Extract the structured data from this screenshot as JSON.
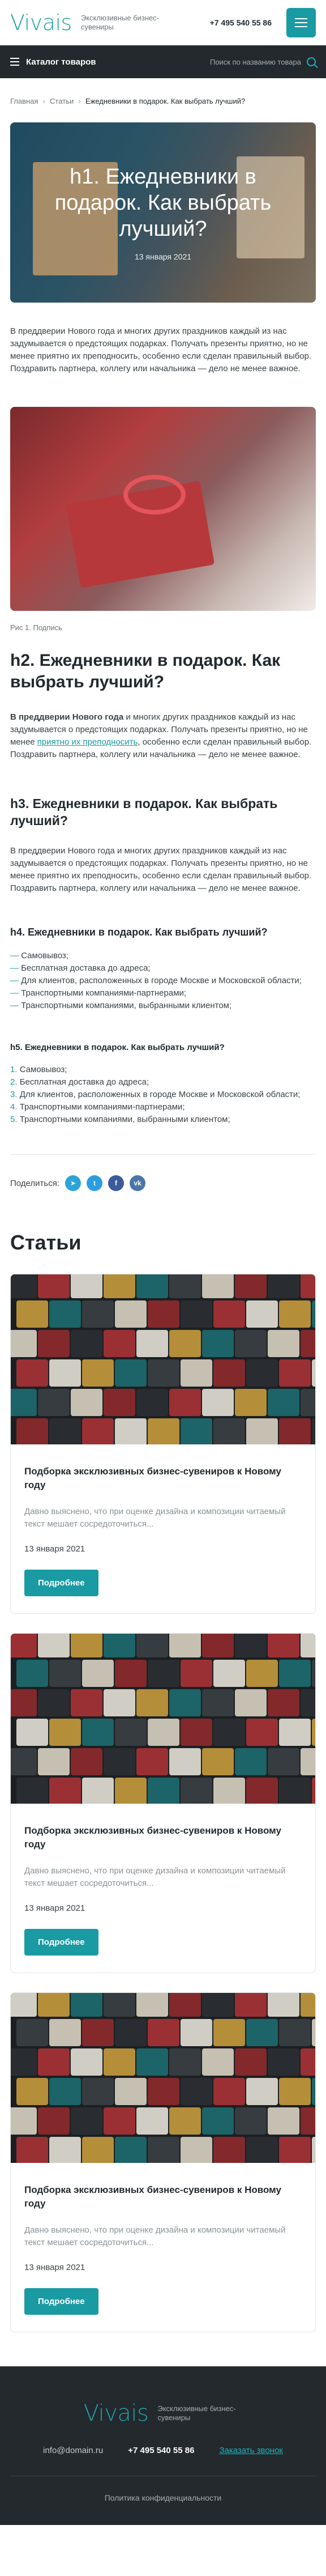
{
  "header": {
    "logo": "Vivais",
    "logo_sub": "Эксклюзивные бизнес-сувениры",
    "phone": "+7 495 540 55 86"
  },
  "catbar": {
    "label": "Каталог товаров",
    "search_placeholder": "Поиск по названию товара"
  },
  "breadcrumb": {
    "items": [
      "Главная",
      "Статьи",
      "Ежедневники в подарок. Как выбрать лучший?"
    ],
    "separator": "›"
  },
  "hero": {
    "title": "h1. Ежедневники в подарок. Как выбрать лучший?",
    "date": "13 января 2021"
  },
  "article": {
    "intro": "В преддверии Нового года и многих других праздников каждый из нас задумывается о предстоящих подарках. Получать презенты приятно, но не менее приятно их преподносить, особенно если сделан правильный выбор. Поздравить партнера, коллегу или начальника — дело не менее важное.",
    "caption": "Рис 1. Подпись",
    "h2": "h2. Ежедневники в подарок. Как выбрать лучший?",
    "p2_bold": "В преддверии Нового года",
    "p2_a": " и многих других праздников каждый из нас задумывается о предстоящих подарках. Получать презенты приятно, но не менее ",
    "p2_link": "приятно их преподносить",
    "p2_b": ", особенно если сделан правильный выбор. Поздравить партнера, коллегу или начальника — дело не менее важное.",
    "h3": "h3. Ежедневники в подарок. Как выбрать лучший?",
    "p3": "В преддверии Нового года и многих других праздников каждый из нас задумывается о предстоящих подарках. Получать презенты приятно, но не менее приятно их преподносить, особенно если сделан правильный выбор. Поздравить партнера, коллегу или начальника — дело не менее важное.",
    "h4": "h4. Ежедневники в подарок. Как выбрать лучший?",
    "ul": [
      {
        "mark": "— ",
        "text": "Самовывоз;"
      },
      {
        "mark": "— ",
        "text": "Бесплатная доставка до адреса;"
      },
      {
        "mark": "— ",
        "text": "Для клиентов, расположенных в городе Москве и Московской области;"
      },
      {
        "mark": "— ",
        "text": "Транспортными компаниями-партнерами;"
      },
      {
        "mark": "— ",
        "text": "Транспортными компаниями, выбранными клиентом;"
      }
    ],
    "h5": "h5. Ежедневники в подарок. Как выбрать лучший?",
    "ol": [
      {
        "mark": "1. ",
        "text": "Самовывоз;"
      },
      {
        "mark": "2. ",
        "text": "Бесплатная доставка до адреса;"
      },
      {
        "mark": "3. ",
        "text": "Для клиентов, расположенных в городе Москве и Московской области;"
      },
      {
        "mark": "4. ",
        "text": "Транспортными компаниями-партнерами;"
      },
      {
        "mark": "5. ",
        "text": "Транспортными компаниями, выбранными клиентом;"
      }
    ]
  },
  "share": {
    "label": "Поделиться:",
    "networks": [
      "tg",
      "tw",
      "fb",
      "vk"
    ]
  },
  "articles": {
    "title": "Статьи",
    "cards": [
      {
        "title": "Подборка эксклюзивных бизнес-сувениров к Новому году",
        "text": "Давно выяснено, что при оценке дизайна и композиции читаемый текст мешает сосредоточиться...",
        "date": "13 января 2021",
        "button": "Подробнее"
      },
      {
        "title": "Подборка эксклюзивных бизнес-сувениров к Новому году",
        "text": "Давно выяснено, что при оценке дизайна и композиции читаемый текст мешает сосредоточиться...",
        "date": "13 января 2021",
        "button": "Подробнее"
      },
      {
        "title": "Подборка эксклюзивных бизнес-сувениров к Новому году",
        "text": "Давно выяснено, что при оценке дизайна и композиции читаемый текст мешает сосредоточиться...",
        "date": "13 января 2021",
        "button": "Подробнее"
      }
    ]
  },
  "footer": {
    "logo": "Vivais",
    "logo_sub": "Эксклюзивные бизнес-сувениры",
    "email": "info@domain.ru",
    "phone": "+7 495 540 55 86",
    "callback": "Заказать звонок",
    "policy": "Политика конфиденциальности"
  },
  "colors": {
    "accent": "#1a9aa3",
    "dark": "#23292d"
  }
}
